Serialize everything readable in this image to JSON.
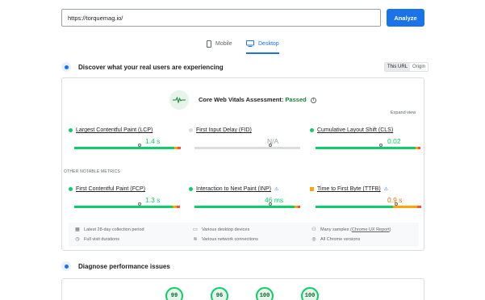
{
  "search": {
    "value": "https://torquemag.io/",
    "analyze_label": "Analyze"
  },
  "tabs": [
    {
      "label": "Mobile",
      "icon": "mobile-icon",
      "selected": false
    },
    {
      "label": "Desktop",
      "icon": "desktop-icon",
      "selected": true
    }
  ],
  "discover": {
    "title": "Discover what your real users are experiencing",
    "this_url": "This URL",
    "origin": "Origin"
  },
  "assessment": {
    "prefix": "Core Web Vitals Assessment:",
    "status": "Passed",
    "expand": "Expand view"
  },
  "core_metrics": [
    {
      "name": "Largest Contentful Paint (LCP)",
      "value": "1.4 s",
      "status": "good",
      "marker_fraction": 0.62
    },
    {
      "name": "First Input Delay (FID)",
      "value": "N/A",
      "status": "none",
      "marker_fraction": 0.72
    },
    {
      "name": "Cumulative Layout Shift (CLS)",
      "value": "0.02",
      "status": "good",
      "marker_fraction": 0.62
    }
  ],
  "other_label": "OTHER NOTABLE METRICS",
  "other_metrics": [
    {
      "name": "First Contentful Paint (FCP)",
      "value": "1.3 s",
      "status": "good",
      "experimental": false,
      "marker_fraction": 0.62
    },
    {
      "name": "Interaction to Next Paint (INP)",
      "value": "46 ms",
      "status": "good",
      "experimental": true,
      "marker_fraction": 0.72
    },
    {
      "name": "Time to First Byte (TTFB)",
      "value": "0.9 s",
      "status": "average",
      "experimental": true,
      "marker_fraction": 0.76
    }
  ],
  "info": {
    "collection_period": "Latest 28-day collection period",
    "devices": "Various desktop devices",
    "samples_prefix": "Many samples (",
    "samples_link": "Chrome UX Report",
    "samples_suffix": ")",
    "durations": "Full visit durations",
    "network": "Various network connections",
    "chrome_versions": "All Chrome versions"
  },
  "diagnose": {
    "title": "Diagnose performance issues"
  },
  "scores": [
    "99",
    "96",
    "100",
    "100"
  ],
  "colors": {
    "good": "#0cce6b",
    "average": "#ffa400",
    "poor": "#ff4e42",
    "none": "#dadce0",
    "accent": "#1a73e8"
  }
}
